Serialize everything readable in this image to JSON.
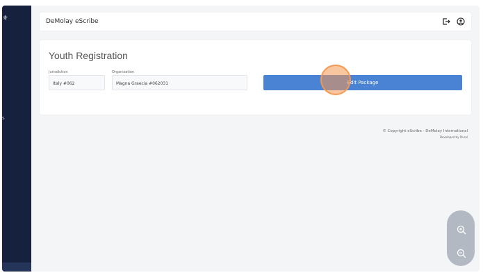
{
  "header": {
    "brand": "DeMolay eScribe",
    "logout_icon": "logout-icon",
    "user_icon": "user-circle-icon"
  },
  "sidebar": {
    "logo_glyph": "⚜",
    "nav_fragment": "s"
  },
  "card": {
    "title": "Youth Registration",
    "jurisdiction_label": "Jurisdiction",
    "jurisdiction_value": "Italy #062",
    "organization_label": "Organization",
    "organization_value": "Magna Graecia #062031",
    "edit_button": "Edit Package"
  },
  "footer": {
    "copyright": "© Copyright eScribe - DeMolay International",
    "developed": "Developed by Plural"
  },
  "zoom": {
    "zoom_in_icon": "zoom-in-icon",
    "zoom_out_icon": "zoom-out-icon"
  },
  "colors": {
    "sidebar": "#16223d",
    "accent": "#4a83d4",
    "click_marker": "#f49850"
  }
}
